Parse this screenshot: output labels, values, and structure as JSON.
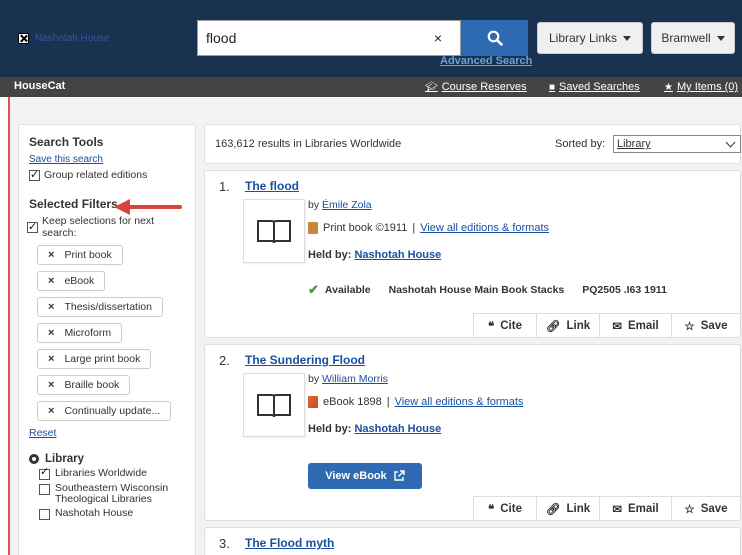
{
  "header": {
    "logo_text": "Nashotah House",
    "search_value": "flood",
    "clear_symbol": "×",
    "advanced_search": "Advanced Search",
    "library_links": "Library Links",
    "user": "Bramwell",
    "bg_color": "#18324f"
  },
  "nav": {
    "home": "HouseCat",
    "links": [
      "Course Reserves",
      "Saved Searches",
      "My Items (0)"
    ]
  },
  "sidebar": {
    "search_tools": "Search Tools",
    "save_search": "Save this search",
    "group_editions": "Group related editions",
    "selected_filters": "Selected Filters",
    "keep_selections": "Keep selections for next search:",
    "filters": [
      "Print book",
      "eBook",
      "Thesis/dissertation",
      "Microform",
      "Large print book",
      "Braille book",
      "Continually update..."
    ],
    "reset": "Reset",
    "facet_title": "Library",
    "facet_items": [
      "Libraries Worldwide",
      "Southeastern Wisconsin Theological Libraries",
      "Nashotah House"
    ]
  },
  "results": {
    "count": "163,612 results in Libraries Worldwide",
    "sorted_by": "Sorted by:",
    "sort_value": "Library",
    "items": [
      {
        "num": "1.",
        "title": "The flood",
        "by": "by",
        "author": "Émile Zola",
        "format": "Print book ©1911",
        "sep": "|",
        "view_all": "View all editions & formats",
        "held_label": "Held by:",
        "held_lib": "Nashotah House",
        "available": "Available",
        "location": "Nashotah House Main Book Stacks",
        "callno": "PQ2505 .I63 1911"
      },
      {
        "num": "2.",
        "title": "The Sundering Flood",
        "by": "by",
        "author": "William Morris",
        "format": "eBook 1898",
        "sep": "|",
        "view_all": "View all editions & formats",
        "held_label": "Held by:",
        "held_lib": "Nashotah House",
        "view_ebook": "View eBook"
      },
      {
        "num": "3.",
        "title": "The Flood myth"
      }
    ],
    "actions": [
      "Cite",
      "Link",
      "Email",
      "Save"
    ]
  }
}
